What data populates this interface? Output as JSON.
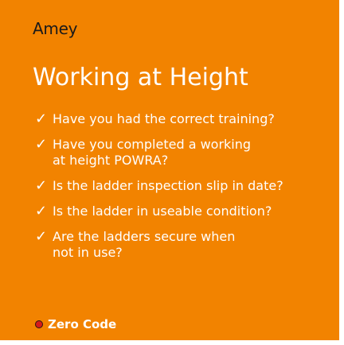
{
  "brand": "Amey",
  "title": "Working at Height",
  "checklist": [
    {
      "lines": [
        "Have you had the correct training?"
      ]
    },
    {
      "lines": [
        "Have you completed a working",
        "at height POWRA?"
      ]
    },
    {
      "lines": [
        "Is the ladder inspection slip in date?"
      ]
    },
    {
      "lines": [
        "Is the ladder in useable condition?"
      ]
    },
    {
      "lines": [
        "Are the ladders secure when",
        "not in use?"
      ]
    }
  ],
  "check_glyph": "✓",
  "footer": {
    "text": "Zero Code",
    "dot_color": "#d61a1a"
  },
  "colors": {
    "background": "#f28300",
    "text": "#ffffff",
    "brand_text": "#1a1a1a"
  }
}
